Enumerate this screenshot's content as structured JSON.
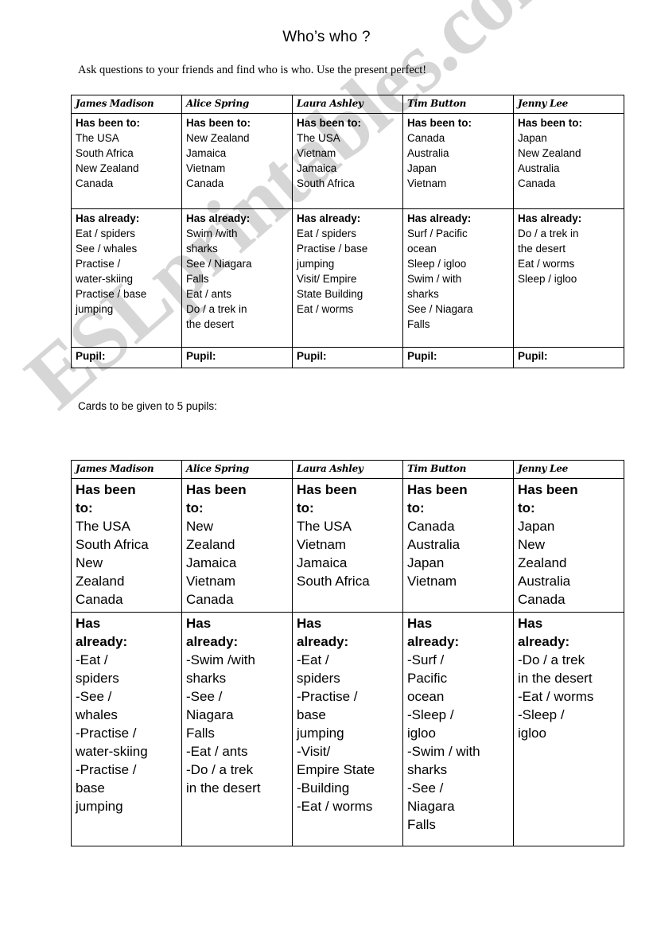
{
  "document": {
    "title": "Who’s who ?",
    "instruction": "Ask questions to your friends and find who is who. Use the present perfect!",
    "cards_note": "Cards to be given to 5 pupils:",
    "watermark": "ESLprintables.com",
    "watermark_color": "#c9c9c9",
    "page_background": "#ffffff",
    "text_color": "#000000",
    "border_color": "#000000"
  },
  "labels": {
    "has_been_to": "Has been to:",
    "has_already": "Has already:",
    "pupil": "Pupil:"
  },
  "roleplay_table": {
    "names": [
      "James Madison",
      "Alice Spring",
      "Laura Ashley",
      "Tim Button",
      "Jenny Lee"
    ],
    "been_to": [
      [
        "The USA",
        "South Africa",
        "New Zealand",
        "Canada"
      ],
      [
        "New Zealand",
        "Jamaica",
        "Vietnam",
        "Canada"
      ],
      [
        "The USA",
        "Vietnam",
        "Jamaica",
        "South Africa"
      ],
      [
        "Canada",
        "Australia",
        "Japan",
        "Vietnam"
      ],
      [
        "Japan",
        "New Zealand",
        "Australia",
        "Canada"
      ]
    ],
    "already": [
      [
        "Eat / spiders",
        "See / whales",
        "Practise /",
        "water-skiing",
        "Practise / base",
        "jumping"
      ],
      [
        "Swim /with",
        "sharks",
        "See / Niagara",
        "Falls",
        "Eat / ants",
        "Do / a trek in",
        "the desert"
      ],
      [
        "Eat / spiders",
        "Practise / base",
        "jumping",
        "Visit/ Empire",
        "State Building",
        "Eat / worms"
      ],
      [
        "Surf / Pacific",
        "ocean",
        "Sleep / igloo",
        "Swim / with",
        "sharks",
        "See / Niagara",
        "Falls"
      ],
      [
        "Do / a trek in",
        "the desert",
        "Eat / worms",
        "Sleep / igloo"
      ]
    ],
    "pupil_labels": [
      "Pupil:",
      "Pupil:",
      "Pupil:",
      "Pupil:",
      "Pupil:"
    ]
  },
  "cards_table": {
    "names": [
      "James Madison",
      "Alice Spring",
      "Laura Ashley",
      "Tim Button",
      "Jenny Lee"
    ],
    "been_to_label_lines": [
      "Has been",
      "to:"
    ],
    "already_label_lines": [
      "Has",
      "already:"
    ],
    "been_to": [
      [
        "The USA",
        "South Africa",
        "New",
        "Zealand",
        "Canada"
      ],
      [
        "New",
        "Zealand",
        "Jamaica",
        "Vietnam",
        "Canada"
      ],
      [
        "The USA",
        "Vietnam",
        "Jamaica",
        "South Africa"
      ],
      [
        "Canada",
        "Australia",
        "Japan",
        "Vietnam"
      ],
      [
        "Japan",
        "New",
        "Zealand",
        "Australia",
        "Canada"
      ]
    ],
    "already": [
      [
        "-Eat /",
        "spiders",
        "-See /",
        "whales",
        "-Practise /",
        "water-skiing",
        "-Practise /",
        "base",
        "jumping"
      ],
      [
        "-Swim /with",
        "sharks",
        "-See /",
        "Niagara",
        "Falls",
        "-Eat / ants",
        "-Do / a trek",
        "in the desert"
      ],
      [
        "-Eat /",
        "spiders",
        "-Practise /",
        "base",
        "jumping",
        "-Visit/",
        "Empire State",
        "-Building",
        "-Eat / worms"
      ],
      [
        "-Surf /",
        "Pacific",
        "ocean",
        "-Sleep /",
        "igloo",
        "-Swim / with",
        "sharks",
        "-See /",
        "Niagara",
        "Falls"
      ],
      [
        "-Do / a trek",
        "in the desert",
        "-Eat / worms",
        "-Sleep /",
        "igloo"
      ]
    ]
  }
}
